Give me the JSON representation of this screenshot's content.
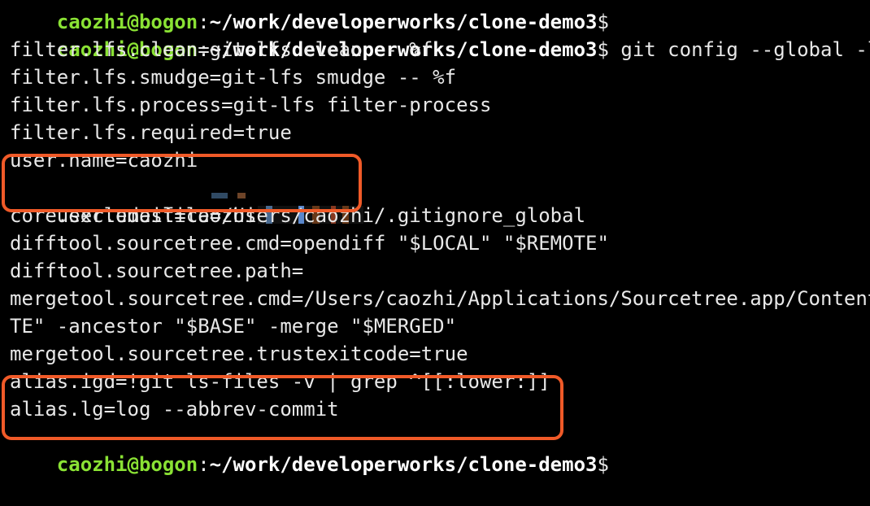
{
  "terminal": {
    "prompt": {
      "user_host": "caozhi@bogon",
      "colon": ":",
      "path": "~/work/developerworks/clone-demo3",
      "sign": "$"
    },
    "command": " git config --global -l",
    "lines": [
      "filter.lfs.clean=git-lfs clean -- %f",
      "filter.lfs.smudge=git-lfs smudge -- %f",
      "filter.lfs.process=git-lfs filter-process",
      "filter.lfs.required=true",
      "user.name=caozhi",
      "user.email=caozhi",
      "core.excludesfile=/Users/caozhi/.gitignore_global",
      "difftool.sourcetree.cmd=opendiff \"$LOCAL\" \"$REMOTE\"",
      "difftool.sourcetree.path=",
      "mergetool.sourcetree.cmd=/Users/caozhi/Applications/Sourcetree.app/Contents/",
      "TE\" -ancestor \"$BASE\" -merge \"$MERGED\"",
      "mergetool.sourcetree.trustexitcode=true",
      "alias.igd=!git ls-files -v | grep ^[[:lower:]]",
      "alias.lg=log --abbrev-commit"
    ]
  },
  "colors": {
    "background": "#000000",
    "text": "#e8e8e8",
    "prompt_user": "#8ae234",
    "highlight": "#f05a28"
  }
}
